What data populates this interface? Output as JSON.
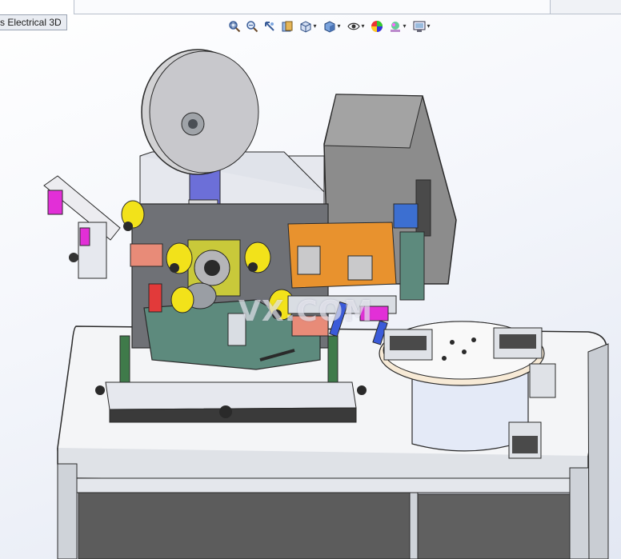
{
  "window": {
    "tab_label": "s Electrical 3D"
  },
  "toolbar": {
    "buttons": [
      {
        "icon": "zoom-to-fit-icon"
      },
      {
        "icon": "zoom-to-area-icon"
      },
      {
        "icon": "previous-view-icon"
      },
      {
        "icon": "section-view-icon"
      },
      {
        "icon": "view-orientation-icon",
        "has_dropdown": true
      },
      {
        "icon": "display-style-icon",
        "has_dropdown": true
      },
      {
        "icon": "hide-show-items-icon",
        "has_dropdown": true
      },
      {
        "icon": "edit-appearance-icon"
      },
      {
        "icon": "apply-scene-icon",
        "has_dropdown": true
      },
      {
        "icon": "view-settings-icon",
        "has_dropdown": true
      }
    ]
  },
  "model": {
    "watermark": "VX.COM",
    "colors": {
      "roller_yellow": "#f2e21a",
      "bracket_green": "#5d8a7d",
      "plate_orange": "#e8922e",
      "frame_gray": "#d9dde3",
      "housing_gray": "#8a8a8a",
      "accent_blue": "#3b5bd9",
      "accent_magenta": "#e22fd7"
    }
  }
}
